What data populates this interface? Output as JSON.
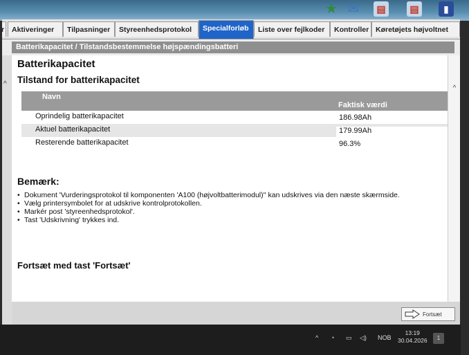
{
  "tabs": [
    "Aktiveringer",
    "Tilpasninger",
    "Styreenhedsprotokol",
    "Specialforløb",
    "Liste over fejlkoder",
    "Kontroller",
    "Køretøjets højvoltnet"
  ],
  "active_tab": "Specialforløb",
  "breadcrumb": "Batterikapacitet / Tilstandsbestemmelse højspændingsbatteri",
  "page_title": "Batterikapacitet",
  "section_title": "Tilstand for batterikapacitet",
  "table": {
    "headers": [
      "Navn",
      "Faktisk værdi"
    ],
    "rows": [
      {
        "name": "Oprindelig batterikapacitet",
        "value": "186.98Ah"
      },
      {
        "name": "Aktuel batterikapacitet",
        "value": "179.99Ah"
      },
      {
        "name": "Resterende batterikapacitet",
        "value": "96.3%"
      }
    ]
  },
  "remark": {
    "title": "Bemærk:",
    "items": [
      "Dokument 'Vurderingsprotokol til komponenten 'A100 (højvoltbatterimodul)'' kan udskrives via den næste skærmside.",
      "Vælg printersymbolet for at udskrive kontrolprotokollen.",
      "Markér post 'styreenhedsprotokol'.",
      "Tast 'Udskrivning' trykkes ind."
    ]
  },
  "continue_text": "Fortsæt med tast 'Fortsæt'",
  "continue_button": "Fortsæt",
  "taskbar": {
    "lang": "NOB",
    "time": "13:19",
    "date": "30.04.2026",
    "notification_count": "1"
  },
  "colors": {
    "active_tab": "#1f64c8",
    "header_gray": "#9a9a9a"
  }
}
